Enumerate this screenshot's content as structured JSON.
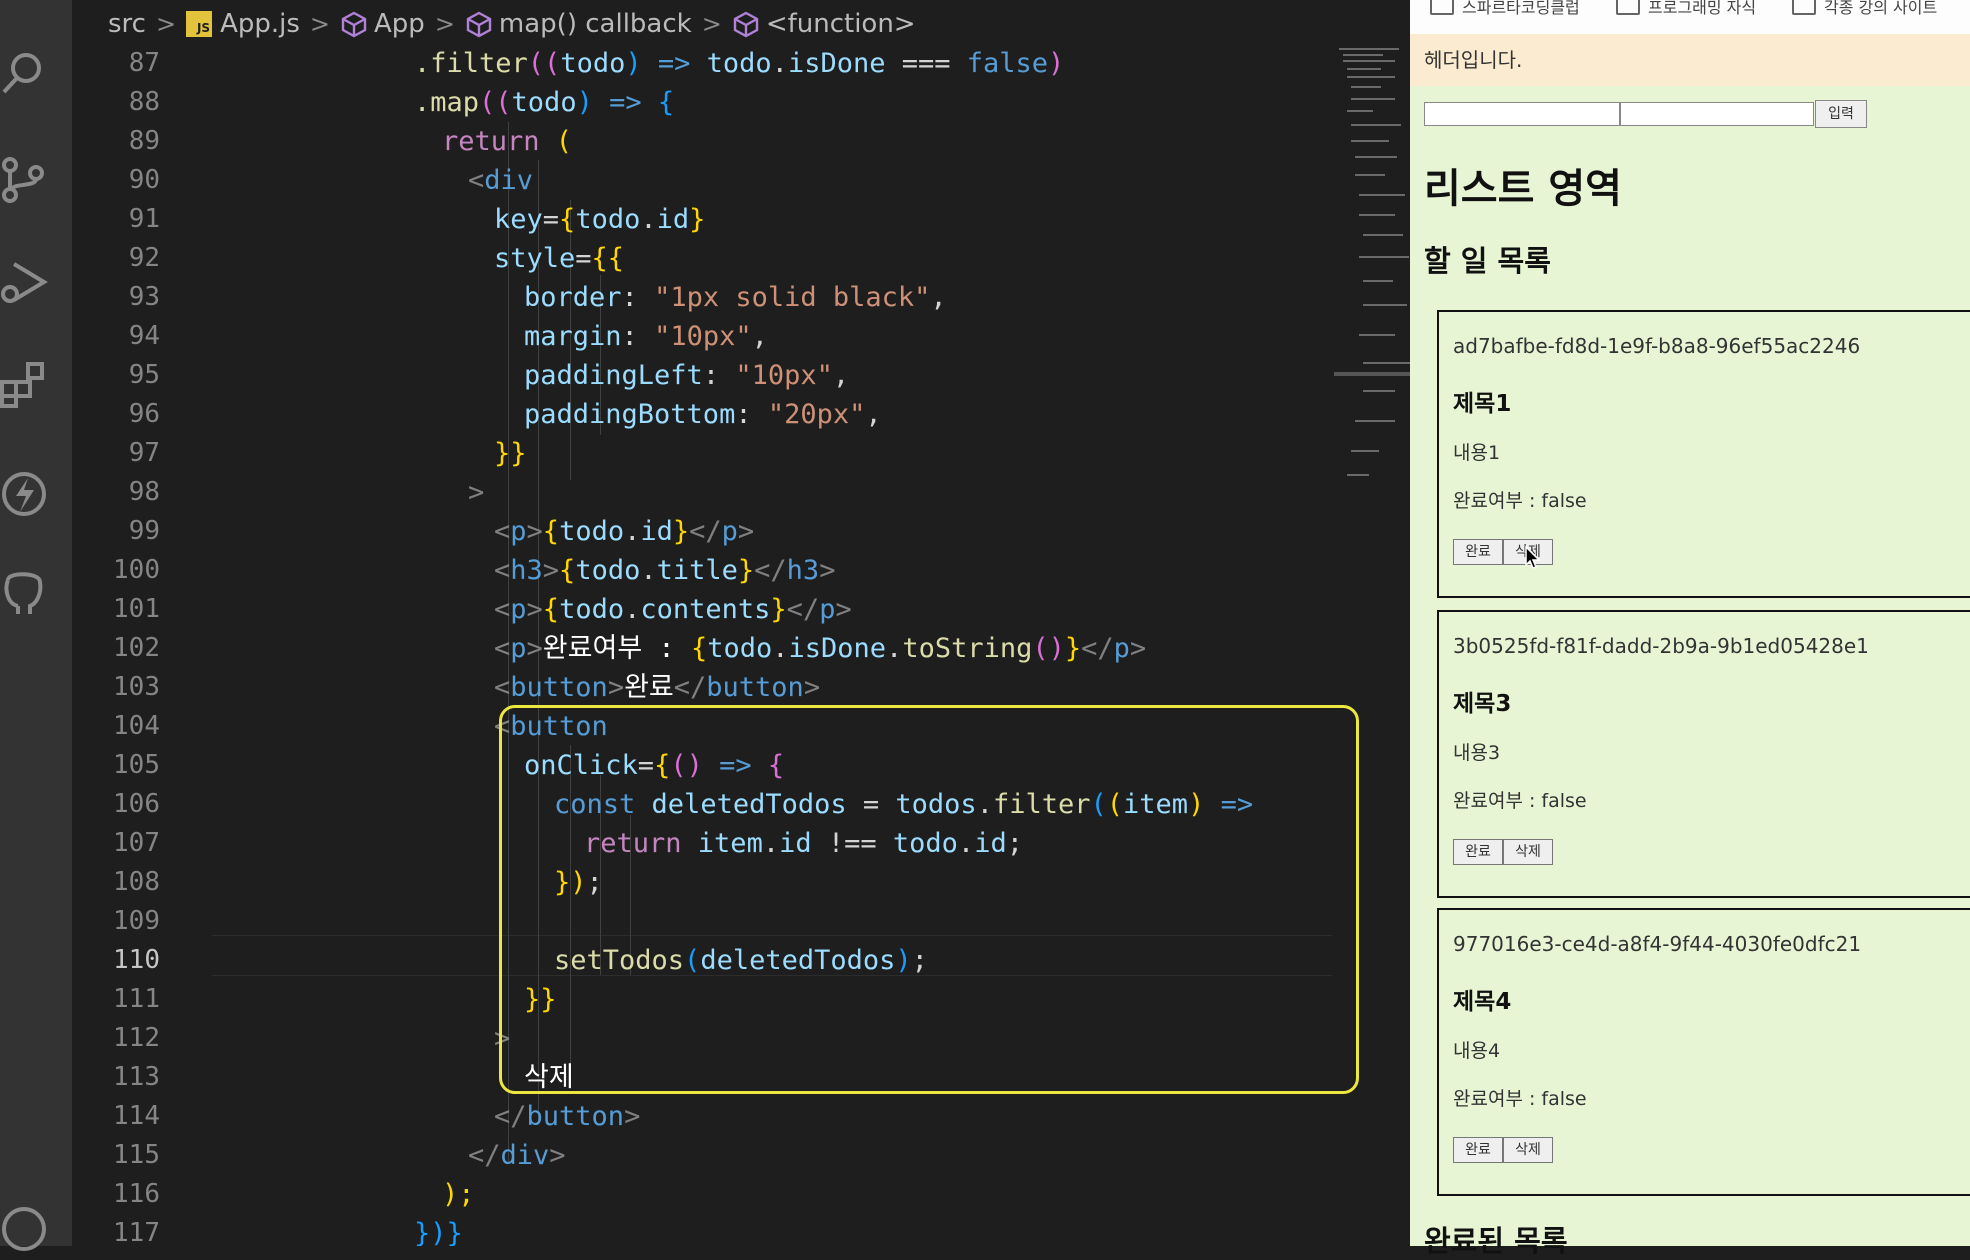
{
  "breadcrumb": {
    "items": [
      "src",
      "App.js",
      "App",
      "map() callback",
      "<function>"
    ]
  },
  "editor": {
    "line_numbers": [
      "87",
      "88",
      "89",
      "90",
      "91",
      "92",
      "93",
      "94",
      "95",
      "96",
      "97",
      "98",
      "99",
      "100",
      "101",
      "102",
      "103",
      "104",
      "105",
      "106",
      "107",
      "108",
      "109",
      "110",
      "111",
      "112",
      "113",
      "114",
      "115",
      "116",
      "117"
    ],
    "active_line": "110",
    "code": {
      "l87": [
        ".filter",
        "((",
        "todo",
        ")",
        " => ",
        "todo",
        ".",
        "isDone",
        " === ",
        "false",
        ")"
      ],
      "l88": [
        ".map",
        "((",
        "todo",
        ")",
        " => ",
        "{"
      ],
      "l89": [
        "return",
        " ("
      ],
      "l90": [
        "<",
        "div"
      ],
      "l91": [
        "key",
        "=",
        "{",
        "todo",
        ".",
        "id",
        "}"
      ],
      "l92": [
        "style",
        "=",
        "{{"
      ],
      "l93": [
        "border",
        ": ",
        "\"1px solid black\"",
        ","
      ],
      "l94": [
        "margin",
        ": ",
        "\"10px\"",
        ","
      ],
      "l95": [
        "paddingLeft",
        ": ",
        "\"10px\"",
        ","
      ],
      "l96": [
        "paddingBottom",
        ": ",
        "\"20px\"",
        ","
      ],
      "l97": [
        "}}"
      ],
      "l98": [
        ">"
      ],
      "l99": [
        "<",
        "p",
        ">",
        "{",
        "todo",
        ".",
        "id",
        "}",
        "</",
        "p",
        ">"
      ],
      "l100": [
        "<",
        "h3",
        ">",
        "{",
        "todo",
        ".",
        "title",
        "}",
        "</",
        "h3",
        ">"
      ],
      "l101": [
        "<",
        "p",
        ">",
        "{",
        "todo",
        ".",
        "contents",
        "}",
        "</",
        "p",
        ">"
      ],
      "l102": [
        "<",
        "p",
        ">",
        "완료여부 : ",
        "{",
        "todo",
        ".",
        "isDone",
        ".",
        "toString",
        "()",
        "}",
        "</",
        "p",
        ">"
      ],
      "l103": [
        "<",
        "button",
        ">",
        "완료",
        "</",
        "button",
        ">"
      ],
      "l104": [
        "<",
        "button"
      ],
      "l105": [
        "onClick",
        "=",
        "{",
        "()",
        " => ",
        "{"
      ],
      "l106": [
        "const ",
        "deletedTodos",
        " = ",
        "todos",
        ".",
        "filter",
        "(",
        "(",
        "item",
        ")",
        " =>"
      ],
      "l107": [
        "return ",
        "item",
        ".",
        "id",
        " !== ",
        "todo",
        ".",
        "id",
        ";"
      ],
      "l108": [
        "})",
        ";"
      ],
      "l110": [
        "setTodos",
        "(",
        "deletedTodos",
        ")",
        ";"
      ],
      "l111": [
        "}}"
      ],
      "l112": [
        ">"
      ],
      "l113": [
        "삭제"
      ],
      "l114": [
        "</",
        "button",
        ">"
      ],
      "l115": [
        "</",
        "div",
        ">"
      ],
      "l116": [
        ");"
      ],
      "l117": [
        "})}"
      ]
    }
  },
  "browser": {
    "bookmarks": [
      "스파르타코딩클럽",
      "프로그래밍 자식",
      "각종 강의 사이트"
    ],
    "header_text": "헤더입니다.",
    "submit_label": "입력",
    "list_title": "리스트 영역",
    "todo_section_title": "할 일 목록",
    "done_section_title": "완료된 목록",
    "done_label": "완료",
    "delete_label": "삭제",
    "cards": [
      {
        "id": "ad7bafbe-fd8d-1e9f-b8a8-96ef55ac2246",
        "title": "제목1",
        "contents": "내용1",
        "done": "완료여부 : false"
      },
      {
        "id": "3b0525fd-f81f-dadd-2b9a-9b1ed05428e1",
        "title": "제목3",
        "contents": "내용3",
        "done": "완료여부 : false"
      },
      {
        "id": "977016e3-ce4d-a8f4-9f44-4030fe0dfc21",
        "title": "제목4",
        "contents": "내용4",
        "done": "완료여부 : false"
      }
    ]
  },
  "colors": {
    "editor_bg": "#1e1e1e",
    "highlight_box": "#ece73e",
    "header_bg": "#fbebd0",
    "page_bg": "#e7f5d5"
  }
}
